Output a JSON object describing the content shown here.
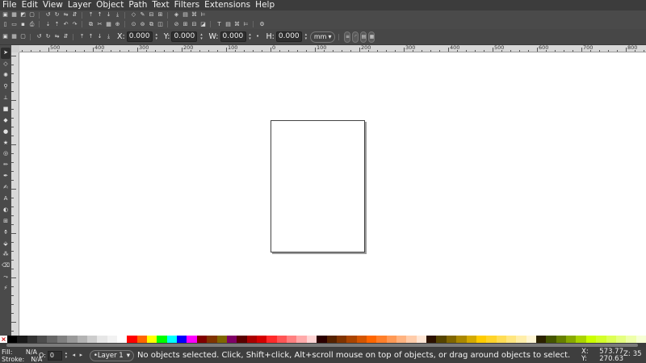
{
  "menu": [
    "File",
    "Edit",
    "View",
    "Layer",
    "Object",
    "Path",
    "Text",
    "Filters",
    "Extensions",
    "Help"
  ],
  "toolbar1_icons": [
    "select-all-icon",
    "select-in-layers-icon",
    "invert-selection-icon",
    "deselect-icon",
    "rotate-ccw-icon",
    "rotate-cw-icon",
    "flip-h-icon",
    "flip-v-icon",
    "raise-top-icon",
    "raise-icon",
    "lower-icon",
    "lower-bottom-icon",
    "node-icon",
    "bezier-icon",
    "ungroup-icon",
    "group-icon",
    "symbols-icon",
    "objects-icon",
    "xml-icon",
    "align-icon"
  ],
  "toolbar2_icons": [
    "new-icon",
    "open-icon",
    "save-icon",
    "print-icon",
    "import-icon",
    "export-icon",
    "undo-icon",
    "redo-icon",
    "copy-icon",
    "cut-icon",
    "paste-icon",
    "zoom-selection-icon",
    "zoom-drawing-icon",
    "zoom-page-icon",
    "duplicate-icon",
    "clone-icon",
    "unlink-icon",
    "group-icon",
    "ungroup-icon",
    "fill-stroke-icon",
    "text-font-icon",
    "layers-icon",
    "xml-editor-icon",
    "align-distribute-icon",
    "preferences-icon"
  ],
  "controls": {
    "x_label": "X:",
    "x_value": "0.000",
    "y_label": "Y:",
    "y_value": "0.000",
    "w_label": "W:",
    "w_value": "0.000",
    "h_label": "H:",
    "h_value": "0.000",
    "unit": "mm"
  },
  "ruler_labels": [
    "500",
    "400",
    "300",
    "200",
    "100",
    "0",
    "100",
    "200",
    "300",
    "400",
    "500",
    "600",
    "700",
    "800"
  ],
  "tools": [
    "selector-icon",
    "node-icon",
    "tweak-icon",
    "zoom-icon",
    "measure-icon",
    "rect-icon",
    "3dbox-icon",
    "ellipse-icon",
    "star-icon",
    "spiral-icon",
    "pencil-icon",
    "pen-icon",
    "calligraphy-icon",
    "text-icon",
    "gradient-icon",
    "mesh-icon",
    "dropper-icon",
    "paint-bucket-icon",
    "spray-icon",
    "eraser-icon",
    "connector-icon",
    "lpe-icon"
  ],
  "palette_colors": [
    "#000000",
    "#1a1a1a",
    "#333333",
    "#4d4d4d",
    "#666666",
    "#808080",
    "#999999",
    "#b3b3b3",
    "#cccccc",
    "#e6e6e6",
    "#f2f2f2",
    "#ffffff",
    "#ff0000",
    "#ff6600",
    "#ffff00",
    "#00ff00",
    "#00ffff",
    "#0000ff",
    "#ff00ff",
    "#800000",
    "#803300",
    "#806600",
    "#800066",
    "#5a0000",
    "#aa0000",
    "#d40000",
    "#ff2a2a",
    "#ff5555",
    "#ff8080",
    "#ffaaaa",
    "#ffd5d5",
    "#2b0000",
    "#552200",
    "#803300",
    "#aa4400",
    "#d45500",
    "#ff6600",
    "#ff7f2a",
    "#ff9955",
    "#ffb380",
    "#ffccaa",
    "#ffe6d5",
    "#2b1100",
    "#554400",
    "#806600",
    "#aa8800",
    "#d4aa00",
    "#ffcc00",
    "#ffd42a",
    "#ffdd55",
    "#ffe680",
    "#ffeeaa",
    "#fff6d5",
    "#2b2200",
    "#445500",
    "#668000",
    "#88aa00",
    "#aad400",
    "#ccff00",
    "#d4ff2a",
    "#ddff55",
    "#e5ff80",
    "#eeffaa",
    "#f6ffd5"
  ],
  "status": {
    "fill_label": "Fill:",
    "fill_value": "N/A",
    "stroke_label": "Stroke:",
    "stroke_value": "N/A",
    "opacity_label": "O:",
    "opacity_value": "0",
    "layer": "•Layer 1",
    "message": "No objects selected. Click, Shift+click, Alt+scroll mouse on top of objects, or drag around objects to select.",
    "x_label": "X:",
    "x_value": "573.77",
    "y_label": "Y:",
    "y_value": "270.63",
    "zoom_label": "Z:",
    "zoom_value": "35"
  }
}
